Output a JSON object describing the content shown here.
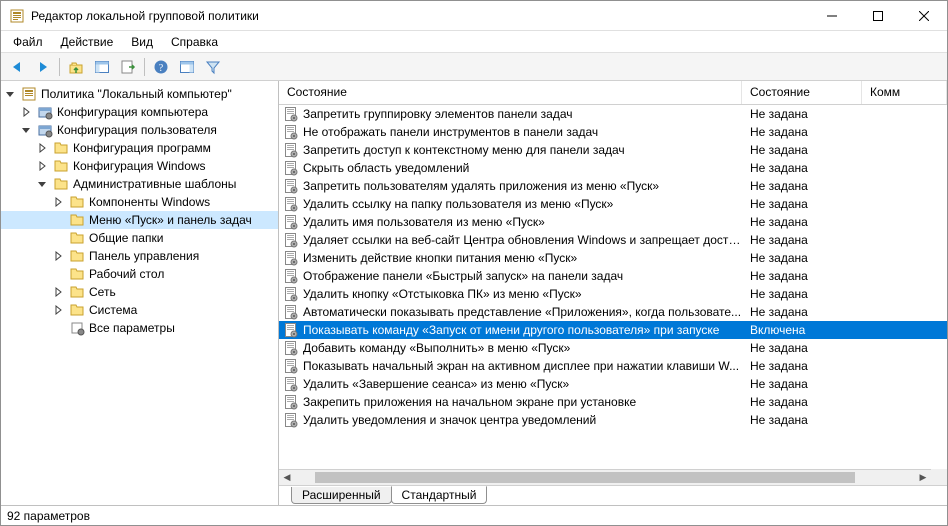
{
  "title": "Редактор локальной групповой политики",
  "menus": [
    "Файл",
    "Действие",
    "Вид",
    "Справка"
  ],
  "toolbar_icons": [
    "back",
    "forward",
    "|",
    "up",
    "show-hide-tree",
    "export",
    "|",
    "help",
    "show-hide-action",
    "filter"
  ],
  "tree": [
    {
      "depth": 0,
      "exp": "open",
      "icon": "root",
      "label": "Политика \"Локальный компьютер\""
    },
    {
      "depth": 1,
      "exp": "closed",
      "icon": "conf",
      "label": "Конфигурация компьютера"
    },
    {
      "depth": 1,
      "exp": "open",
      "icon": "conf",
      "label": "Конфигурация пользователя"
    },
    {
      "depth": 2,
      "exp": "closed",
      "icon": "folder",
      "label": "Конфигурация программ"
    },
    {
      "depth": 2,
      "exp": "closed",
      "icon": "folder",
      "label": "Конфигурация Windows"
    },
    {
      "depth": 2,
      "exp": "open",
      "icon": "folder",
      "label": "Административные шаблоны"
    },
    {
      "depth": 3,
      "exp": "closed",
      "icon": "folder",
      "label": "Компоненты Windows"
    },
    {
      "depth": 3,
      "exp": "leaf",
      "icon": "folder",
      "label": "Меню «Пуск» и панель задач",
      "selected": true
    },
    {
      "depth": 3,
      "exp": "leaf",
      "icon": "folder",
      "label": "Общие папки"
    },
    {
      "depth": 3,
      "exp": "closed",
      "icon": "folder",
      "label": "Панель управления"
    },
    {
      "depth": 3,
      "exp": "leaf",
      "icon": "folder",
      "label": "Рабочий стол"
    },
    {
      "depth": 3,
      "exp": "closed",
      "icon": "folder",
      "label": "Сеть"
    },
    {
      "depth": 3,
      "exp": "closed",
      "icon": "folder",
      "label": "Система"
    },
    {
      "depth": 3,
      "exp": "leaf",
      "icon": "all",
      "label": "Все параметры"
    }
  ],
  "columns": {
    "name": "Состояние",
    "state": "Состояние",
    "comment": "Комментарий",
    "comment_vis": "Комм"
  },
  "policies": [
    {
      "name": "Запретить группировку элементов панели задач",
      "state": "Не задана"
    },
    {
      "name": "Не отображать панели инструментов в панели задач",
      "state": "Не задана"
    },
    {
      "name": "Запретить доступ к контекстному меню для панели задач",
      "state": "Не задана"
    },
    {
      "name": "Скрыть область уведомлений",
      "state": "Не задана"
    },
    {
      "name": "Запретить пользователям удалять приложения из меню «Пуск»",
      "state": "Не задана"
    },
    {
      "name": "Удалить ссылку на папку пользователя из меню «Пуск»",
      "state": "Не задана"
    },
    {
      "name": "Удалить имя пользователя из меню «Пуск»",
      "state": "Не задана"
    },
    {
      "name": "Удаляет ссылки на веб-сайт Центра обновления Windows и запрещает досту...",
      "state": "Не задана"
    },
    {
      "name": "Изменить действие кнопки питания меню «Пуск»",
      "state": "Не задана"
    },
    {
      "name": "Отображение панели «Быстрый запуск» на панели задач",
      "state": "Не задана"
    },
    {
      "name": "Удалить кнопку «Отстыковка ПК» из меню «Пуск»",
      "state": "Не задана"
    },
    {
      "name": "Автоматически показывать представление «Приложения», когда пользовате...",
      "state": "Не задана"
    },
    {
      "name": "Показывать команду «Запуск от имени другого пользователя» при запуске",
      "state": "Включена",
      "selected": true
    },
    {
      "name": "Добавить команду «Выполнить» в меню «Пуск»",
      "state": "Не задана"
    },
    {
      "name": "Показывать начальный экран на активном дисплее при нажатии клавиши W...",
      "state": "Не задана"
    },
    {
      "name": "Удалить «Завершение сеанса» из меню «Пуск»",
      "state": "Не задана"
    },
    {
      "name": "Закрепить приложения на начальном экране при установке",
      "state": "Не задана"
    },
    {
      "name": "Удалить уведомления и значок центра уведомлений",
      "state": "Не задана"
    }
  ],
  "tabs": {
    "extended": "Расширенный",
    "standard": "Стандартный"
  },
  "status": "92 параметров"
}
